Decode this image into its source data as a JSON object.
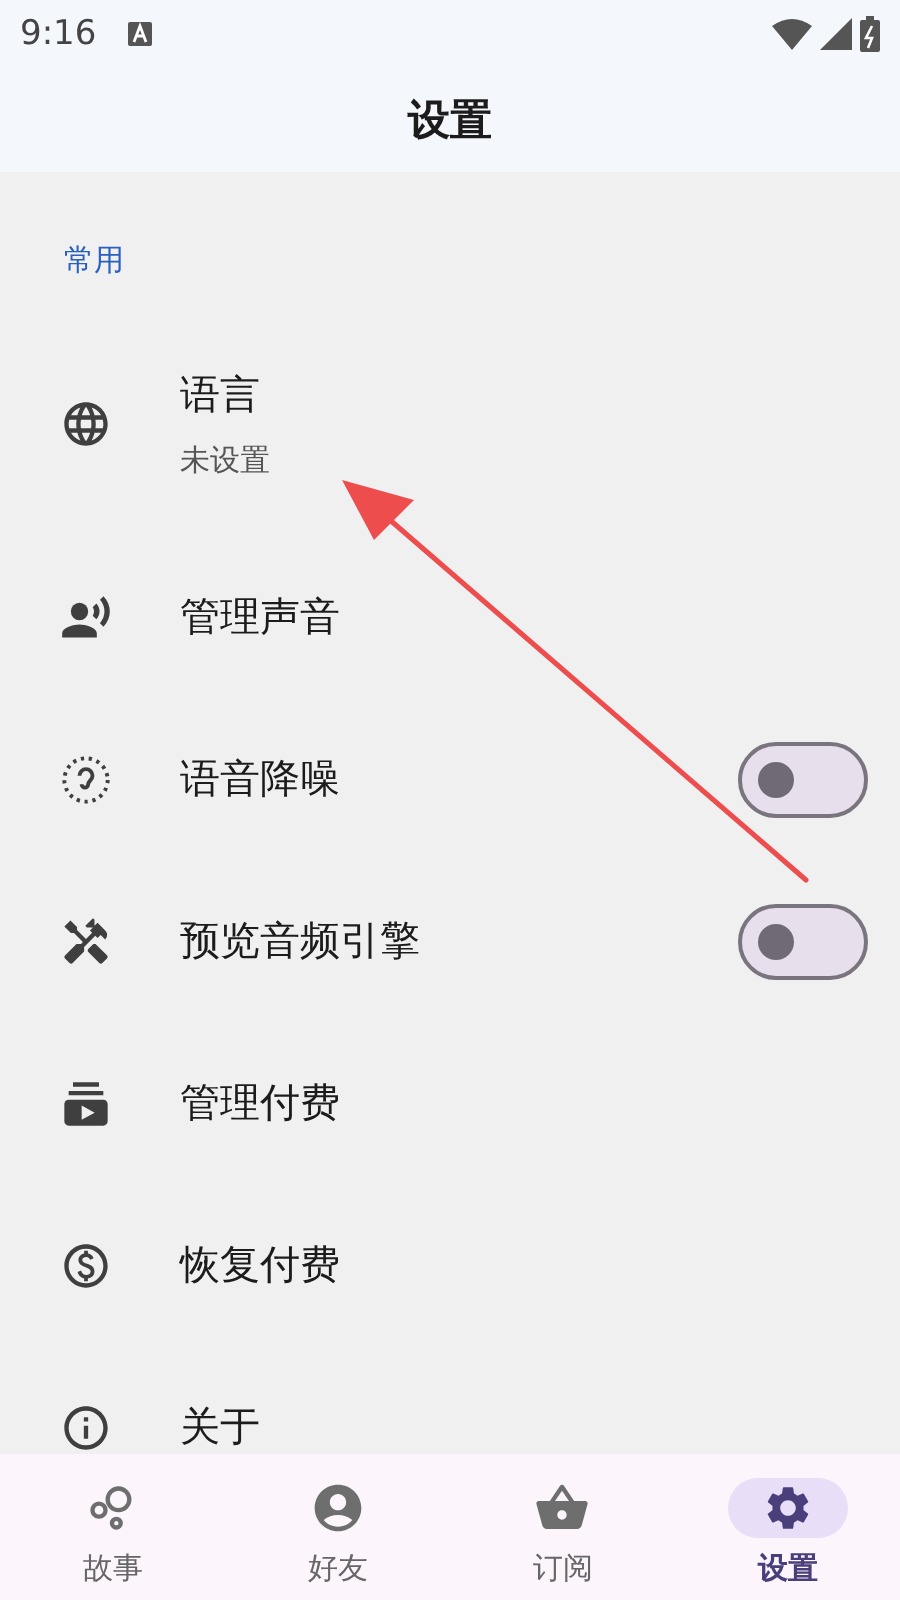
{
  "status_bar": {
    "time": "9:16"
  },
  "header": {
    "title": "设置"
  },
  "section": {
    "label": "常用",
    "items": [
      {
        "kind": "link",
        "title": "语言",
        "subtitle": "未设置"
      },
      {
        "kind": "link",
        "title": "管理声音"
      },
      {
        "kind": "toggle",
        "title": "语音降噪",
        "on": false
      },
      {
        "kind": "toggle",
        "title": "预览音频引擎",
        "on": false
      },
      {
        "kind": "link",
        "title": "管理付费"
      },
      {
        "kind": "link",
        "title": "恢复付费"
      },
      {
        "kind": "link",
        "title": "关于"
      }
    ]
  },
  "bottom_nav": [
    {
      "label": "故事",
      "selected": false
    },
    {
      "label": "好友",
      "selected": false
    },
    {
      "label": "订阅",
      "selected": false
    },
    {
      "label": "设置",
      "selected": true
    }
  ]
}
